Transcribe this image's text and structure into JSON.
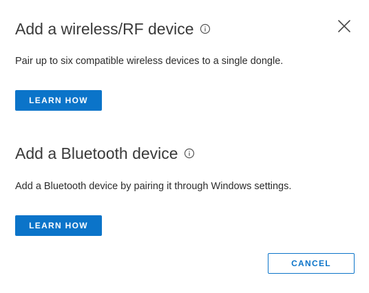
{
  "colors": {
    "accent": "#0b74c9",
    "background": "#ffffff",
    "title_text": "#3a3a3a",
    "body_text": "#2b2b2b"
  },
  "dialog": {
    "close_icon": "close-icon"
  },
  "sections": [
    {
      "title": "Add a wireless/RF device",
      "info_icon": "info-icon",
      "description": "Pair up to six compatible wireless devices to a single dongle.",
      "button_label": "LEARN HOW"
    },
    {
      "title": "Add a Bluetooth device",
      "info_icon": "info-icon",
      "description": "Add a Bluetooth device by pairing it through Windows settings.",
      "button_label": "LEARN HOW"
    }
  ],
  "footer": {
    "cancel_label": "CANCEL"
  }
}
